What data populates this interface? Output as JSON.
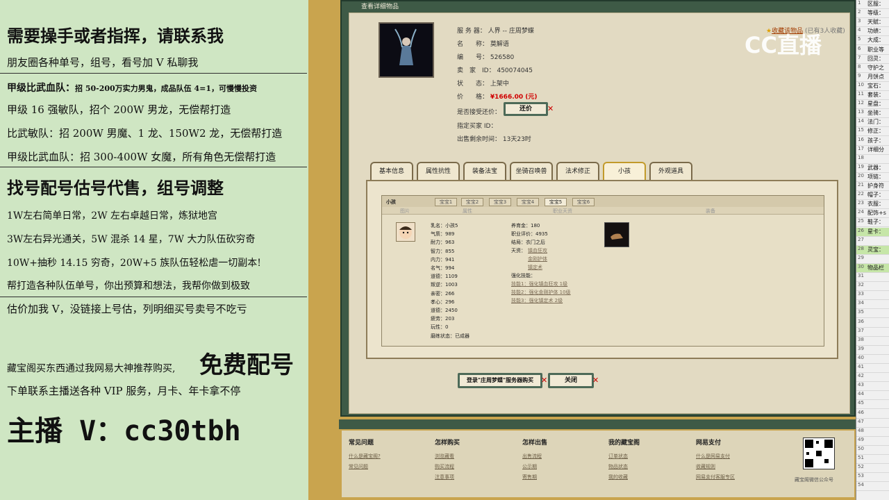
{
  "promo": {
    "l1": "需要操手或者指挥，请联系我",
    "l2": "朋友圈各种单号，组号，看号加 V 私聊我",
    "l3a": "甲级比武血队：",
    "l3b": "招 50-200万实力男鬼，成品队伍 4=1，可慢慢投资",
    "l4": "甲级 16 强敏队，招个 200W 男龙，无偿帮打造",
    "l5": "比武敏队：招 200W 男魔、1 龙、150W2 龙，无偿帮打造",
    "l6": "甲级比武血队：招 300-400W 女魔，所有角色无偿帮打造",
    "l7": "找号配号估号代售，组号调整",
    "l8": "1W左右简单日常，2W 左右卓越日常，炼狱地宫",
    "l9": "3W左右异光通关，5W 混杀 14 星，7W 大力队伍砍穷奇",
    "l10": "10W+抽秒 14.15 穷奇，20W+5 族队伍轻松虐一切副本!",
    "l11": "帮打造各种队伍单号，你出预算和想法，我帮你做到极致",
    "l12": "估价加我 V，没链接上号估，列明细买号卖号不吃亏",
    "l13a": "藏宝阁买东西通过我网易大神推荐购买,",
    "l13b": "免费配号",
    "l14": "下单联系主播送各种 VIP 服务，月卡、年卡拿不停",
    "l15": "主播 V：cc30tbh"
  },
  "window": {
    "title": "查看详细物品",
    "fav": "收藏该物品",
    "fav_count": "(已有3人收藏)"
  },
  "item": {
    "server_label": "服 务 器：",
    "server": "人界 -- 庄周梦蝶",
    "name_label": "名　　称：",
    "name": "莫解语",
    "code_label": "编　　号：",
    "code": "526580",
    "seller_label": "卖　家　ID：",
    "seller": "450074045",
    "status_label": "状　　态：",
    "status": "上架中",
    "price_label": "价　　格：",
    "price": "¥1666.00 (元)",
    "bargain_label": "是否接受还价：",
    "bargain_btn": "还价",
    "buyer_label": "指定买家 ID：",
    "time_label": "出售剩余时间：",
    "time": "13天23时"
  },
  "tabs": [
    "基本信息",
    "属性抗性",
    "装备法宝",
    "坐骑召唤兽",
    "法术修正",
    "小孩",
    "外观道具"
  ],
  "child": {
    "section": "小孩",
    "subtabs": [
      "宝宝1",
      "宝宝2",
      "宝宝3",
      "宝宝4",
      "宝宝5",
      "宝宝6"
    ],
    "col_heads": [
      "图片",
      "属性",
      "职业天资",
      "装备"
    ],
    "attrs": [
      "乳名：小孩5",
      "气质：989",
      "耐力：963",
      "智力：855",
      "内力：941",
      "名气：994",
      "道德：1109",
      "叛逆：1003",
      "亲密：266",
      "孝心：296",
      "道德：2450",
      "疲劳：203",
      "玩性：0",
      "磨练状态：已成器"
    ],
    "raise": "养育金：180",
    "prof": "职业评价：4935",
    "result": "结局：衣门之后",
    "talent_label": "天资：",
    "talents": [
      "镇血狂攻",
      "金刚护体",
      "镇定术"
    ],
    "skill_label": "强化技能：",
    "skills": [
      "技能1：强化镇血狂攻 1级",
      "技能2：强化金刚护体 10级",
      "技能3：强化镇定术 2级"
    ]
  },
  "buttons": {
    "login_buy": "登录\"庄周梦蝶\"服务器购买",
    "close": "关闭"
  },
  "footer": {
    "heads": [
      "常见问题",
      "怎样购买",
      "怎样出售",
      "我的藏宝阁",
      "网易支付"
    ],
    "c1": [
      "什么是藏宝阁?",
      "常见问题"
    ],
    "c2": [
      "浏览藏看",
      "购买流程",
      "注意事项"
    ],
    "c3": [
      "出售流程",
      "公示期",
      "寄售期"
    ],
    "c4": [
      "订单状态",
      "物品状态",
      "我的收藏"
    ],
    "c5": [
      "什么是网易支付",
      "收藏规则",
      "网易支付客服专区"
    ],
    "qr_caption": "藏宝阁微信公众号"
  },
  "right_rows": [
    {
      "n": "1",
      "t": "区服："
    },
    {
      "n": "2",
      "t": "等级："
    },
    {
      "n": "3",
      "t": "天赋："
    },
    {
      "n": "4",
      "t": "功绩："
    },
    {
      "n": "5",
      "t": "大成："
    },
    {
      "n": "6",
      "t": "职业等"
    },
    {
      "n": "7",
      "t": "回灵："
    },
    {
      "n": "8",
      "t": "守护之"
    },
    {
      "n": "9",
      "t": "月饼点"
    },
    {
      "n": "10",
      "t": "宝石："
    },
    {
      "n": "11",
      "t": "套装："
    },
    {
      "n": "12",
      "t": "星盘："
    },
    {
      "n": "13",
      "t": "坐骑："
    },
    {
      "n": "14",
      "t": "法门："
    },
    {
      "n": "15",
      "t": "修正："
    },
    {
      "n": "16",
      "t": "孩子："
    },
    {
      "n": "17",
      "t": "详细分"
    },
    {
      "n": "18",
      "t": ""
    },
    {
      "n": "19",
      "t": "武器："
    },
    {
      "n": "20",
      "t": "项链："
    },
    {
      "n": "21",
      "t": "护身符"
    },
    {
      "n": "22",
      "t": "帽子："
    },
    {
      "n": "23",
      "t": "衣服："
    },
    {
      "n": "24",
      "t": "配饰+s"
    },
    {
      "n": "25",
      "t": "鞋子："
    },
    {
      "n": "26",
      "t": "星卡："
    },
    {
      "n": "27",
      "t": ""
    },
    {
      "n": "28",
      "t": "灵宝："
    },
    {
      "n": "29",
      "t": ""
    },
    {
      "n": "30",
      "t": "物品栏"
    },
    {
      "n": "31",
      "t": ""
    },
    {
      "n": "32",
      "t": ""
    },
    {
      "n": "33",
      "t": ""
    },
    {
      "n": "34",
      "t": ""
    },
    {
      "n": "35",
      "t": ""
    },
    {
      "n": "36",
      "t": ""
    },
    {
      "n": "37",
      "t": ""
    },
    {
      "n": "38",
      "t": ""
    },
    {
      "n": "39",
      "t": ""
    },
    {
      "n": "40",
      "t": ""
    },
    {
      "n": "41",
      "t": ""
    },
    {
      "n": "42",
      "t": ""
    },
    {
      "n": "43",
      "t": ""
    },
    {
      "n": "44",
      "t": ""
    },
    {
      "n": "45",
      "t": ""
    },
    {
      "n": "46",
      "t": ""
    },
    {
      "n": "47",
      "t": ""
    },
    {
      "n": "48",
      "t": ""
    },
    {
      "n": "49",
      "t": ""
    },
    {
      "n": "50",
      "t": ""
    },
    {
      "n": "51",
      "t": ""
    },
    {
      "n": "52",
      "t": ""
    },
    {
      "n": "53",
      "t": ""
    },
    {
      "n": "54",
      "t": ""
    }
  ],
  "watermark": "CC直播",
  "colors": {
    "accent_green": "#3e5a46",
    "price_red": "#d00000",
    "left_bg": "#cfe6c3"
  }
}
